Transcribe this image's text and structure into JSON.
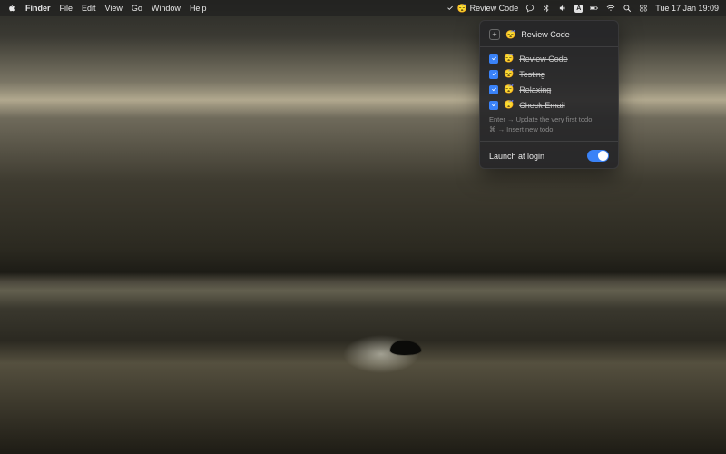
{
  "menubar": {
    "app_name": "Finder",
    "menus": [
      "File",
      "Edit",
      "View",
      "Go",
      "Window",
      "Help"
    ],
    "todo_widget": {
      "emoji": "😴",
      "label": "Review Code"
    },
    "input_source": "A",
    "clock": "Tue 17 Jan  19:09"
  },
  "panel": {
    "new_todo": {
      "emoji": "😴",
      "placeholder": "Review Code"
    },
    "todos": [
      {
        "done": true,
        "emoji": "😴",
        "label": "Review Code"
      },
      {
        "done": true,
        "emoji": "😴",
        "label": "Testing"
      },
      {
        "done": true,
        "emoji": "😴",
        "label": "Relaxing"
      },
      {
        "done": true,
        "emoji": "😴",
        "label": "Check Email"
      }
    ],
    "hints": {
      "line1": "Enter → Update the very first todo",
      "line2": "⌘ → Insert new todo"
    },
    "launch_at_login": {
      "label": "Launch at login",
      "enabled": true
    }
  }
}
